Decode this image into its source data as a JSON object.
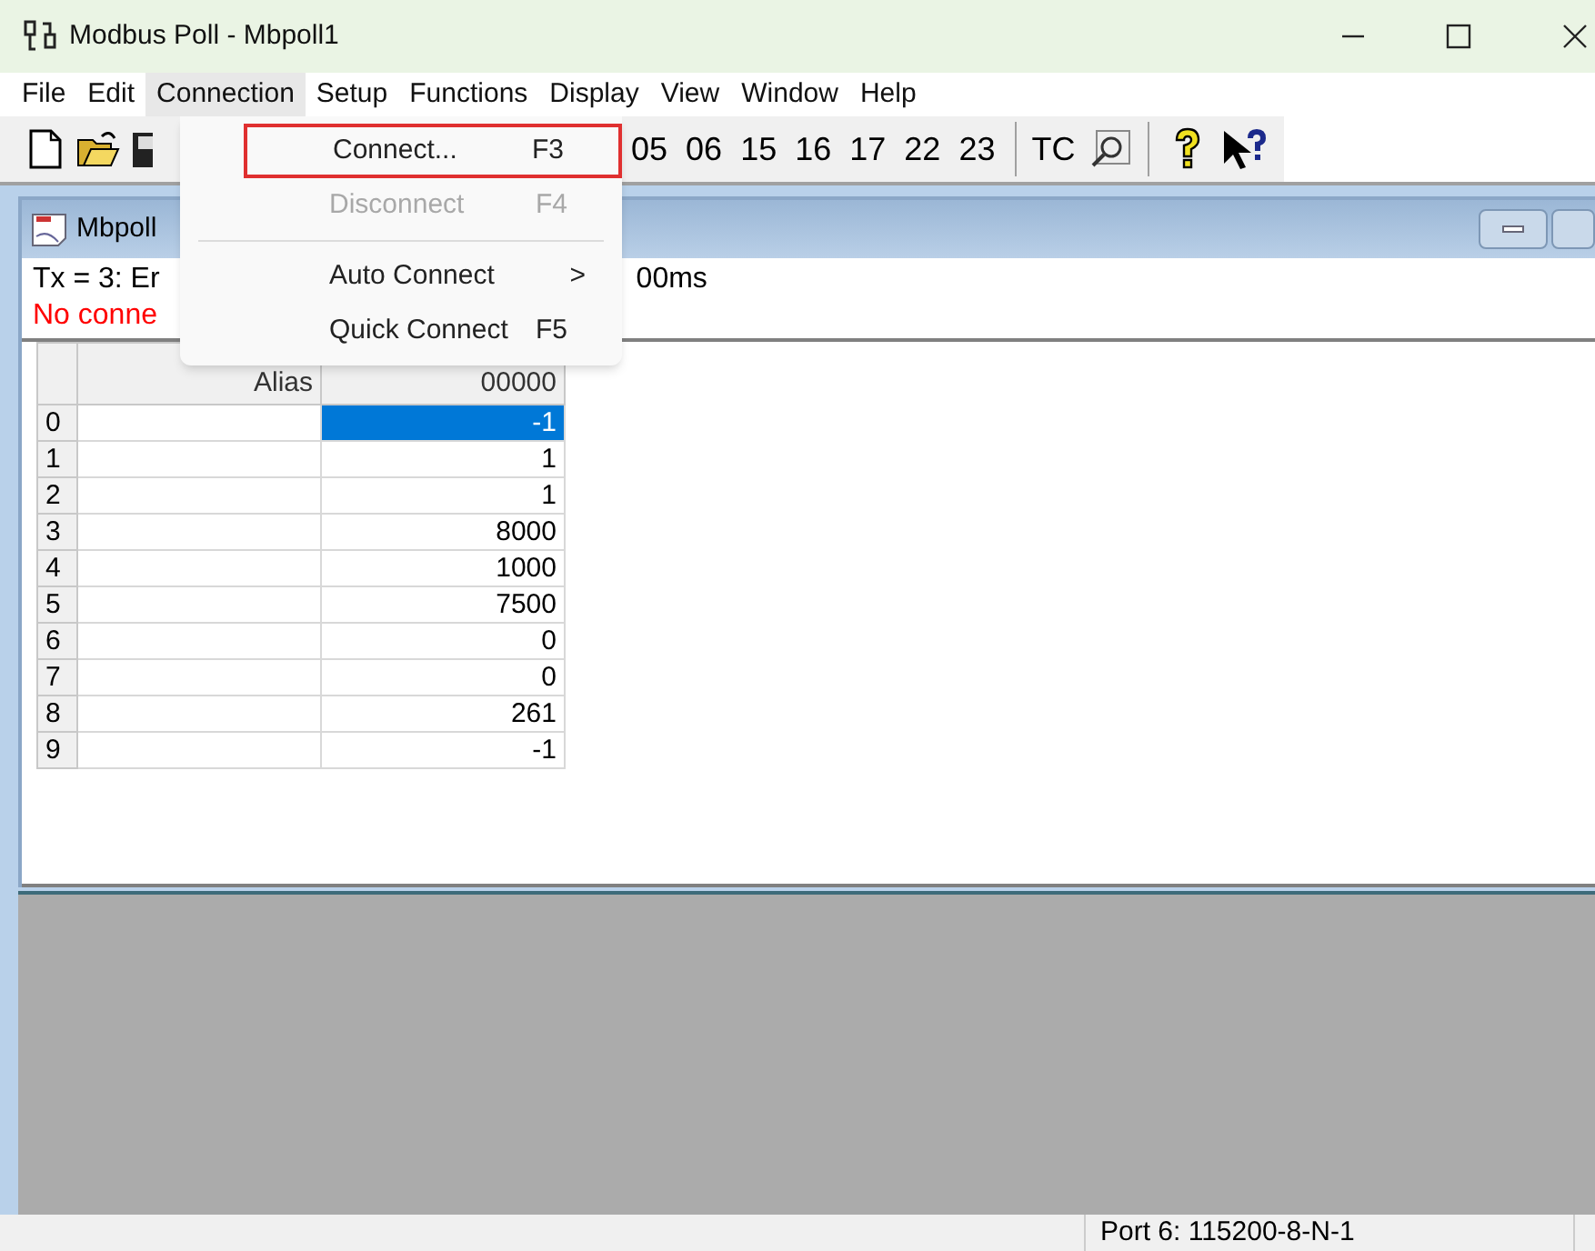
{
  "window": {
    "title": "Modbus Poll - Mbpoll1"
  },
  "menu": [
    {
      "label": "File",
      "selected": false
    },
    {
      "label": "Edit",
      "selected": false
    },
    {
      "label": "Connection",
      "selected": true
    },
    {
      "label": "Setup",
      "selected": false
    },
    {
      "label": "Functions",
      "selected": false
    },
    {
      "label": "Display",
      "selected": false
    },
    {
      "label": "View",
      "selected": false
    },
    {
      "label": "Window",
      "selected": false
    },
    {
      "label": "Help",
      "selected": false
    }
  ],
  "toolbar": {
    "function_buttons": [
      "05",
      "06",
      "15",
      "16",
      "17",
      "22",
      "23"
    ],
    "tc_button": "TC"
  },
  "dropdown": [
    {
      "kind": "item",
      "label": "Connect...",
      "shortcut": "F3",
      "disabled": false,
      "selected": true
    },
    {
      "kind": "item",
      "label": "Disconnect",
      "shortcut": "F4",
      "disabled": true,
      "selected": false
    },
    {
      "kind": "separator"
    },
    {
      "kind": "submenu",
      "label": "Auto Connect",
      "shortcut": ">",
      "disabled": false,
      "selected": false
    },
    {
      "kind": "item",
      "label": "Quick Connect",
      "shortcut": "F5",
      "disabled": false,
      "selected": false
    }
  ],
  "child_window": {
    "title": "Mbpoll",
    "tx_line_start": "Tx = 3: Er",
    "tx_line_end": "00ms",
    "error_text": "No conne"
  },
  "table": {
    "columns": [
      "Alias",
      "00000"
    ],
    "rows": [
      {
        "index": "0",
        "alias": "",
        "value": "-1",
        "selected": true
      },
      {
        "index": "1",
        "alias": "",
        "value": "1",
        "selected": false
      },
      {
        "index": "2",
        "alias": "",
        "value": "1",
        "selected": false
      },
      {
        "index": "3",
        "alias": "",
        "value": "8000",
        "selected": false
      },
      {
        "index": "4",
        "alias": "",
        "value": "1000",
        "selected": false
      },
      {
        "index": "5",
        "alias": "",
        "value": "7500",
        "selected": false
      },
      {
        "index": "6",
        "alias": "",
        "value": "0",
        "selected": false
      },
      {
        "index": "7",
        "alias": "",
        "value": "0",
        "selected": false
      },
      {
        "index": "8",
        "alias": "",
        "value": "261",
        "selected": false
      },
      {
        "index": "9",
        "alias": "",
        "value": "-1",
        "selected": false
      }
    ]
  },
  "status_bar": {
    "port": "Port 6: 115200-8-N-1"
  }
}
